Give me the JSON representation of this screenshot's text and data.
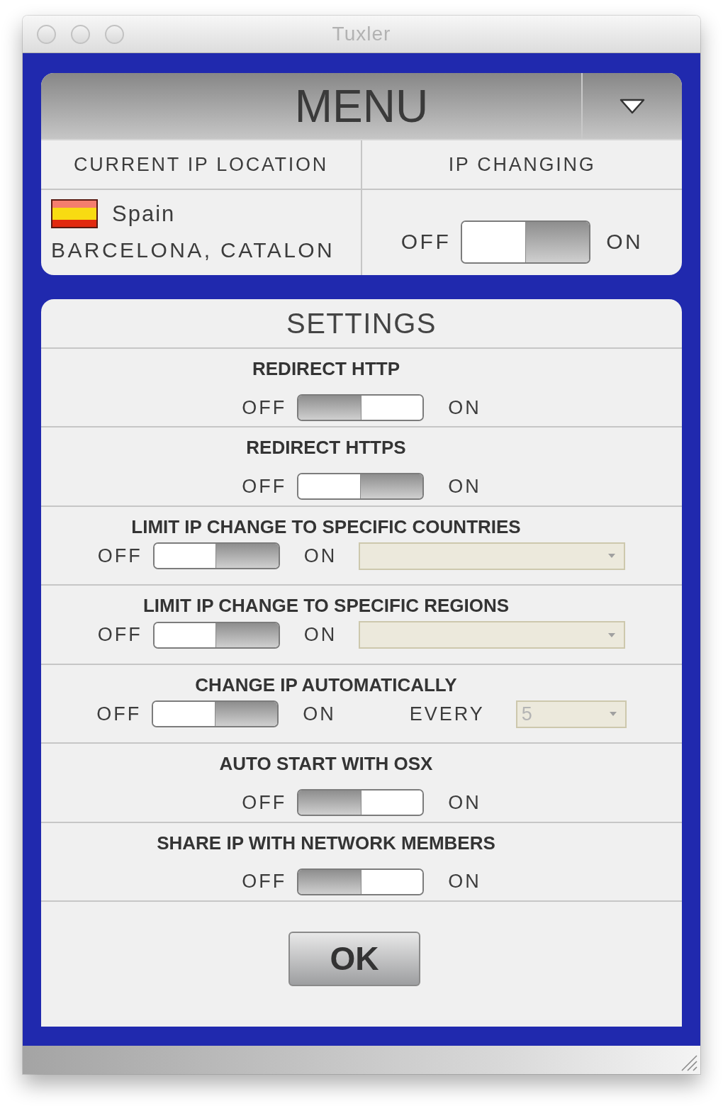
{
  "window": {
    "title": "Tuxler"
  },
  "menu": {
    "title": "MENU"
  },
  "location": {
    "header": "CURRENT IP LOCATION",
    "country": "Spain",
    "city": "BARCELONA, CATALON"
  },
  "ip_changing": {
    "header": "IP CHANGING",
    "off_label": "OFF",
    "on_label": "ON",
    "on": false
  },
  "settings": {
    "title": "SETTINGS",
    "rows": [
      {
        "kind": "toggle",
        "label": "REDIRECT HTTP",
        "off_label": "OFF",
        "on_label": "ON",
        "on": true
      },
      {
        "kind": "toggle",
        "label": "REDIRECT HTTPS",
        "off_label": "OFF",
        "on_label": "ON",
        "on": false
      },
      {
        "kind": "select",
        "label": "LIMIT IP CHANGE TO SPECIFIC COUNTRIES",
        "off_label": "OFF",
        "on_label": "ON",
        "on": false,
        "select": {
          "disabled": true
        }
      },
      {
        "kind": "select",
        "label": "LIMIT IP CHANGE TO SPECIFIC REGIONS",
        "off_label": "OFF",
        "on_label": "ON",
        "on": false,
        "select": {
          "disabled": true
        }
      },
      {
        "kind": "interval",
        "label": "CHANGE IP AUTOMATICALLY",
        "off_label": "OFF",
        "on_label": "ON",
        "on": false,
        "interval_label": "EVERY",
        "select": {
          "value": "5",
          "disabled": true
        }
      },
      {
        "kind": "toggle",
        "label": "AUTO START WITH OSX",
        "off_label": "OFF",
        "on_label": "ON",
        "on": true
      },
      {
        "kind": "toggle",
        "label": "SHARE IP WITH NETWORK MEMBERS",
        "off_label": "OFF",
        "on_label": "ON",
        "on": true
      }
    ]
  },
  "ok_button": {
    "label": "OK"
  }
}
